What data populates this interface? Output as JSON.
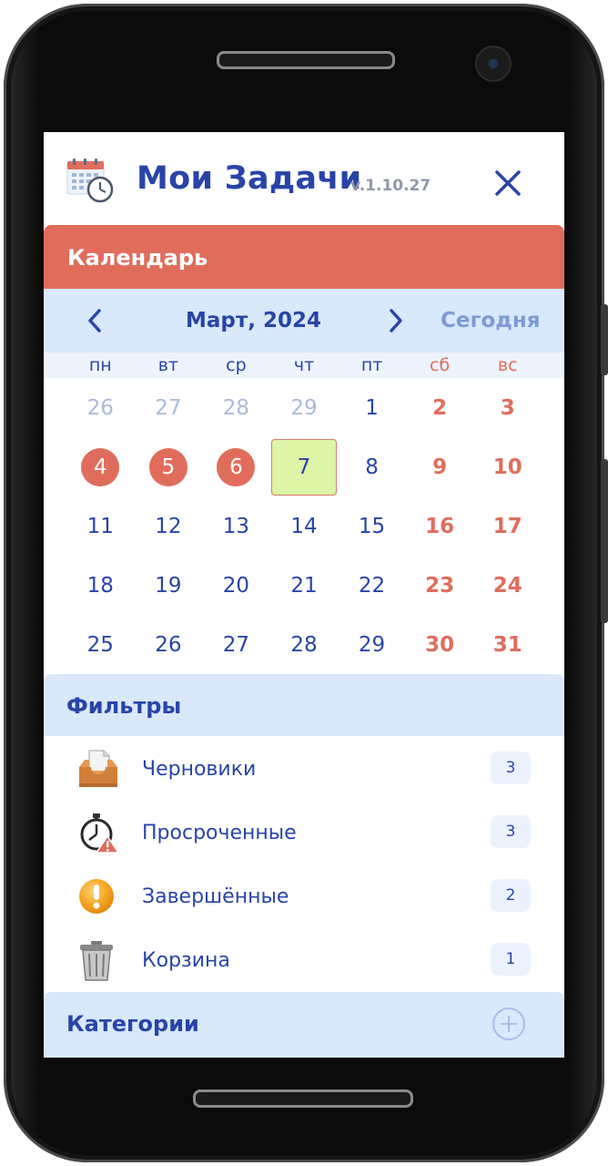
{
  "header": {
    "title": "Мои Задачи",
    "version": "v.1.10.27",
    "logo_icon": "calendar-clock-icon",
    "close_icon": "close-icon"
  },
  "calendar": {
    "section_label": "Календарь",
    "month_label": "Март, 2024",
    "today_label": "Сегодня",
    "weekdays": [
      "пн",
      "вт",
      "ср",
      "чт",
      "пт",
      "сб",
      "вс"
    ],
    "days": [
      {
        "num": "26",
        "state": "muted"
      },
      {
        "num": "27",
        "state": "muted"
      },
      {
        "num": "28",
        "state": "muted"
      },
      {
        "num": "29",
        "state": "muted"
      },
      {
        "num": "1",
        "state": "normal"
      },
      {
        "num": "2",
        "state": "weekend"
      },
      {
        "num": "3",
        "state": "weekend"
      },
      {
        "num": "4",
        "state": "mark"
      },
      {
        "num": "5",
        "state": "mark"
      },
      {
        "num": "6",
        "state": "mark"
      },
      {
        "num": "7",
        "state": "today"
      },
      {
        "num": "8",
        "state": "normal"
      },
      {
        "num": "9",
        "state": "weekend"
      },
      {
        "num": "10",
        "state": "weekend"
      },
      {
        "num": "11",
        "state": "normal"
      },
      {
        "num": "12",
        "state": "normal"
      },
      {
        "num": "13",
        "state": "normal"
      },
      {
        "num": "14",
        "state": "normal"
      },
      {
        "num": "15",
        "state": "normal"
      },
      {
        "num": "16",
        "state": "weekend"
      },
      {
        "num": "17",
        "state": "weekend"
      },
      {
        "num": "18",
        "state": "normal"
      },
      {
        "num": "19",
        "state": "normal"
      },
      {
        "num": "20",
        "state": "normal"
      },
      {
        "num": "21",
        "state": "normal"
      },
      {
        "num": "22",
        "state": "normal"
      },
      {
        "num": "23",
        "state": "weekend"
      },
      {
        "num": "24",
        "state": "weekend"
      },
      {
        "num": "25",
        "state": "normal"
      },
      {
        "num": "26",
        "state": "normal"
      },
      {
        "num": "27",
        "state": "normal"
      },
      {
        "num": "28",
        "state": "normal"
      },
      {
        "num": "29",
        "state": "normal"
      },
      {
        "num": "30",
        "state": "weekend"
      },
      {
        "num": "31",
        "state": "weekend"
      }
    ]
  },
  "filters": {
    "section_label": "Фильтры",
    "items": [
      {
        "label": "Черновики",
        "count": "3",
        "icon": "inbox-tray-icon"
      },
      {
        "label": "Просроченные",
        "count": "3",
        "icon": "stopwatch-warning-icon"
      },
      {
        "label": "Завершённые",
        "count": "2",
        "icon": "exclamation-circle-icon"
      },
      {
        "label": "Корзина",
        "count": "1",
        "icon": "trash-can-icon"
      }
    ]
  },
  "categories": {
    "section_label": "Категории",
    "add_icon": "plus-circle-icon"
  },
  "colors": {
    "accent_red": "#e06d5c",
    "primary_blue": "#2944a8",
    "light_blue": "#d9e8fb",
    "today_green": "#dcf5a6"
  }
}
